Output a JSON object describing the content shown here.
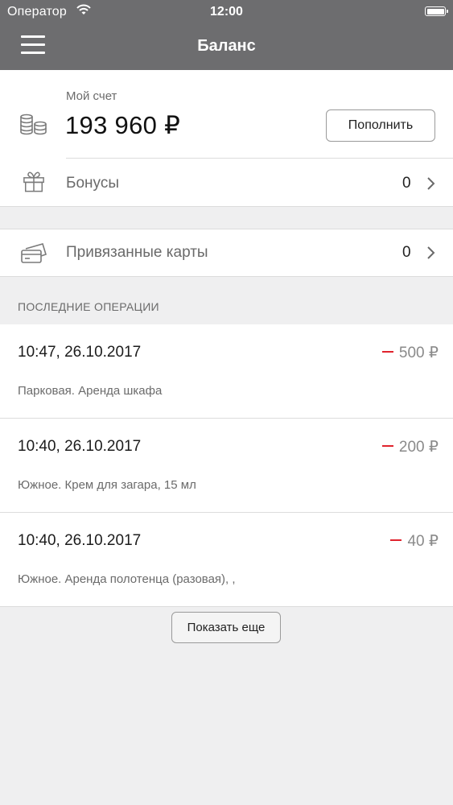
{
  "status_bar": {
    "carrier": "Оператор",
    "time": "12:00"
  },
  "nav": {
    "title": "Баланс"
  },
  "account": {
    "label": "Мой счет",
    "balance": "193 960 ₽",
    "topup_label": "Пополнить"
  },
  "bonuses": {
    "label": "Бонусы",
    "count": "0"
  },
  "cards": {
    "label": "Привязанные карты",
    "count": "0"
  },
  "operations": {
    "header": "ПОСЛЕДНИЕ ОПЕРАЦИИ",
    "items": [
      {
        "datetime": "10:47, 26.10.2017",
        "amount": "500 ₽",
        "description": "Парковая. Аренда шкафа"
      },
      {
        "datetime": "10:40, 26.10.2017",
        "amount": "200 ₽",
        "description": "Южное. Крем для загара, 15 мл"
      },
      {
        "datetime": "10:40, 26.10.2017",
        "amount": "40 ₽",
        "description": "Южное. Аренда полотенца (разовая), ,"
      }
    ]
  },
  "show_more_label": "Показать еще",
  "colors": {
    "nav_bg": "#6d6d6f",
    "page_bg": "#efeff0",
    "minus_red": "#e0232d"
  }
}
